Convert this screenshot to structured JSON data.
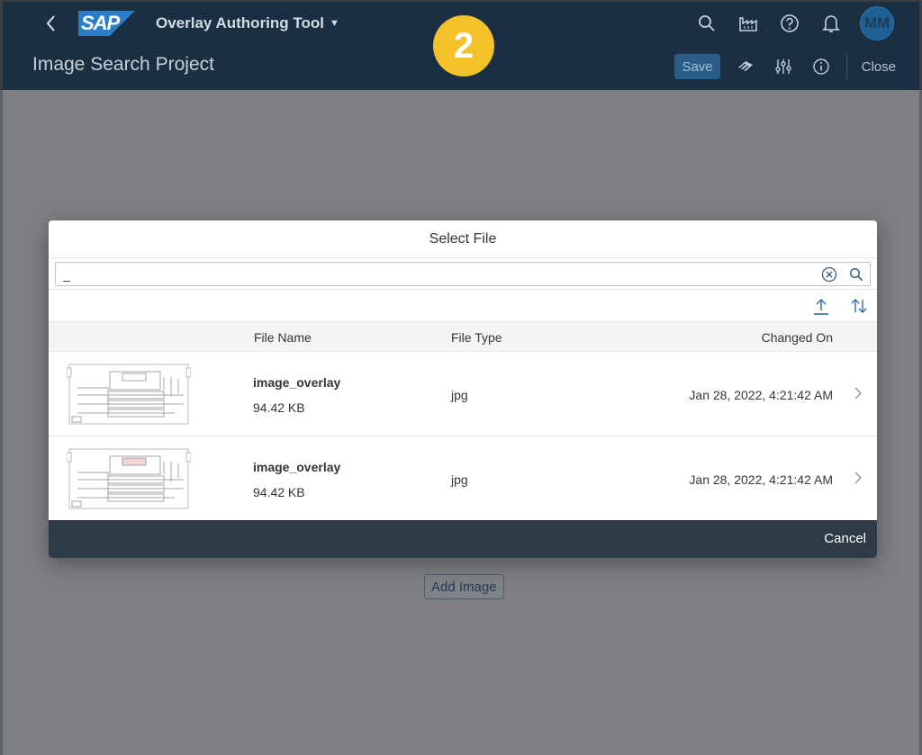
{
  "shell": {
    "logo_text": "SAP",
    "app_title": "Overlay Authoring Tool",
    "step_number": "2",
    "avatar_initials": "MM",
    "icons": [
      "search-icon",
      "factory-icon",
      "help-icon",
      "bell-icon"
    ]
  },
  "header": {
    "page_title": "Image Search Project",
    "save_label": "Save",
    "close_label": "Close"
  },
  "page": {
    "add_image_label": "Add Image"
  },
  "dialog": {
    "title": "Select File",
    "search_value": "_",
    "columns": {
      "file_name": "File Name",
      "file_type": "File Type",
      "changed_on": "Changed On"
    },
    "rows": [
      {
        "name": "image_overlay",
        "size": "94.42 KB",
        "type": "jpg",
        "changed_on": "Jan 28, 2022, 4:21:42 AM"
      },
      {
        "name": "image_overlay",
        "size": "94.42 KB",
        "type": "jpg",
        "changed_on": "Jan 28, 2022, 4:21:42 AM"
      }
    ],
    "cancel_label": "Cancel"
  },
  "colors": {
    "shell_bg": "#1b2f42",
    "accent": "#2b6aa6",
    "badge": "#f3c12a",
    "footer_bg": "#2e3a46"
  }
}
